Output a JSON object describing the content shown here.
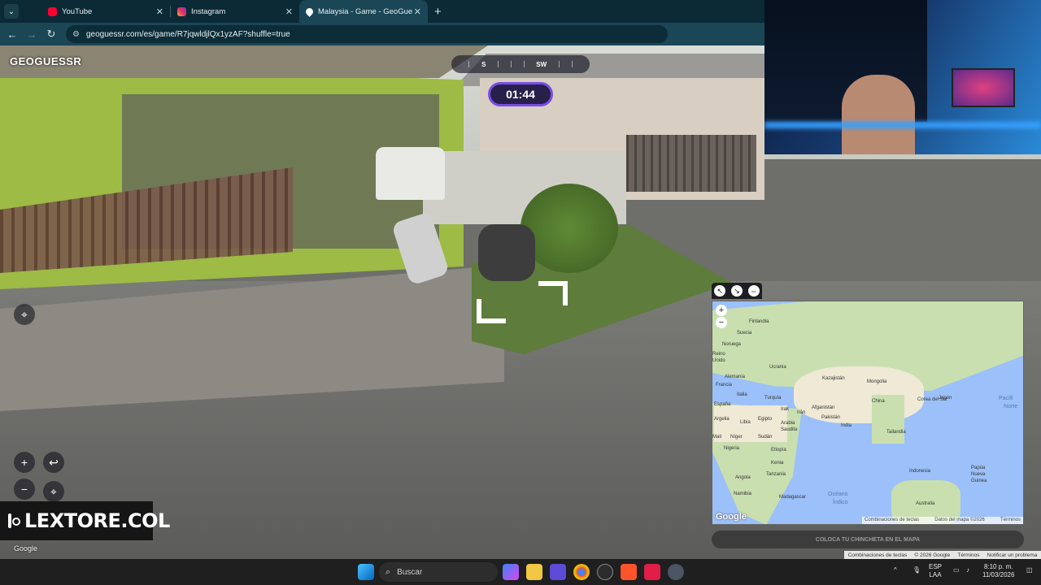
{
  "browser": {
    "tabs": [
      {
        "label": "YouTube",
        "favicon": "youtube-icon",
        "active": false
      },
      {
        "label": "Instagram",
        "favicon": "instagram-icon",
        "active": false
      },
      {
        "label": "Malaysia - Game - GeoGue",
        "favicon": "geoguessr-pin-icon",
        "active": true
      }
    ],
    "new_tab": "+",
    "url": "geoguessr.com/es/game/R7jqwldjlQx1yzAF?shuffle=true"
  },
  "game": {
    "logo": "GEOGUESSR",
    "compass": [
      "S",
      "SW"
    ],
    "timer": "01:44",
    "google_watermark": "Google"
  },
  "overlay": {
    "handle": "LEXTORE.COL"
  },
  "map": {
    "labels": [
      "Finlandia",
      "Suecia",
      "Noruega",
      "Reino",
      "Unido",
      "Ucrania",
      "Alemania",
      "Francia",
      "Italia",
      "España",
      "Kazajistán",
      "Mongolia",
      "China",
      "Corea del Sur",
      "Japón",
      "Turquía",
      "Irak",
      "Irán",
      "Afganistán",
      "Pakistán",
      "India",
      "Arabia",
      "Saudita",
      "Argelia",
      "Libia",
      "Egipto",
      "Malí",
      "Níger",
      "Sudán",
      "Nigeria",
      "Etiopía",
      "Kenia",
      "Tanzania",
      "Angola",
      "Namibia",
      "Madagascar",
      "Tailandia",
      "Indonesia",
      "Papúa",
      "Nueva",
      "Guinea",
      "Australia"
    ],
    "seas": [
      "Pacífi",
      "Norte",
      "Océano",
      "Índico"
    ],
    "zoom_in": "+",
    "zoom_out": "−",
    "google": "Google",
    "footer": [
      "Combinaciones de teclas",
      "Datos del mapa ©2026",
      "Términos"
    ],
    "guess_button": "COLOCA TU CHINCHETA EN EL MAPA"
  },
  "attribution": [
    "Combinaciones de teclas",
    "© 2026 Google",
    "Términos",
    "Notificar un problema"
  ],
  "taskbar": {
    "search_placeholder": "Buscar",
    "lang": "ESP",
    "lang2": "LAA",
    "time": "8:10 p. m.",
    "date": "11/03/2026"
  },
  "colors": {
    "chrome_bg": "#0b2a36",
    "timer_border": "#7a4de6",
    "timer_bg": "#27204b",
    "map_water": "#9cc0f9"
  }
}
